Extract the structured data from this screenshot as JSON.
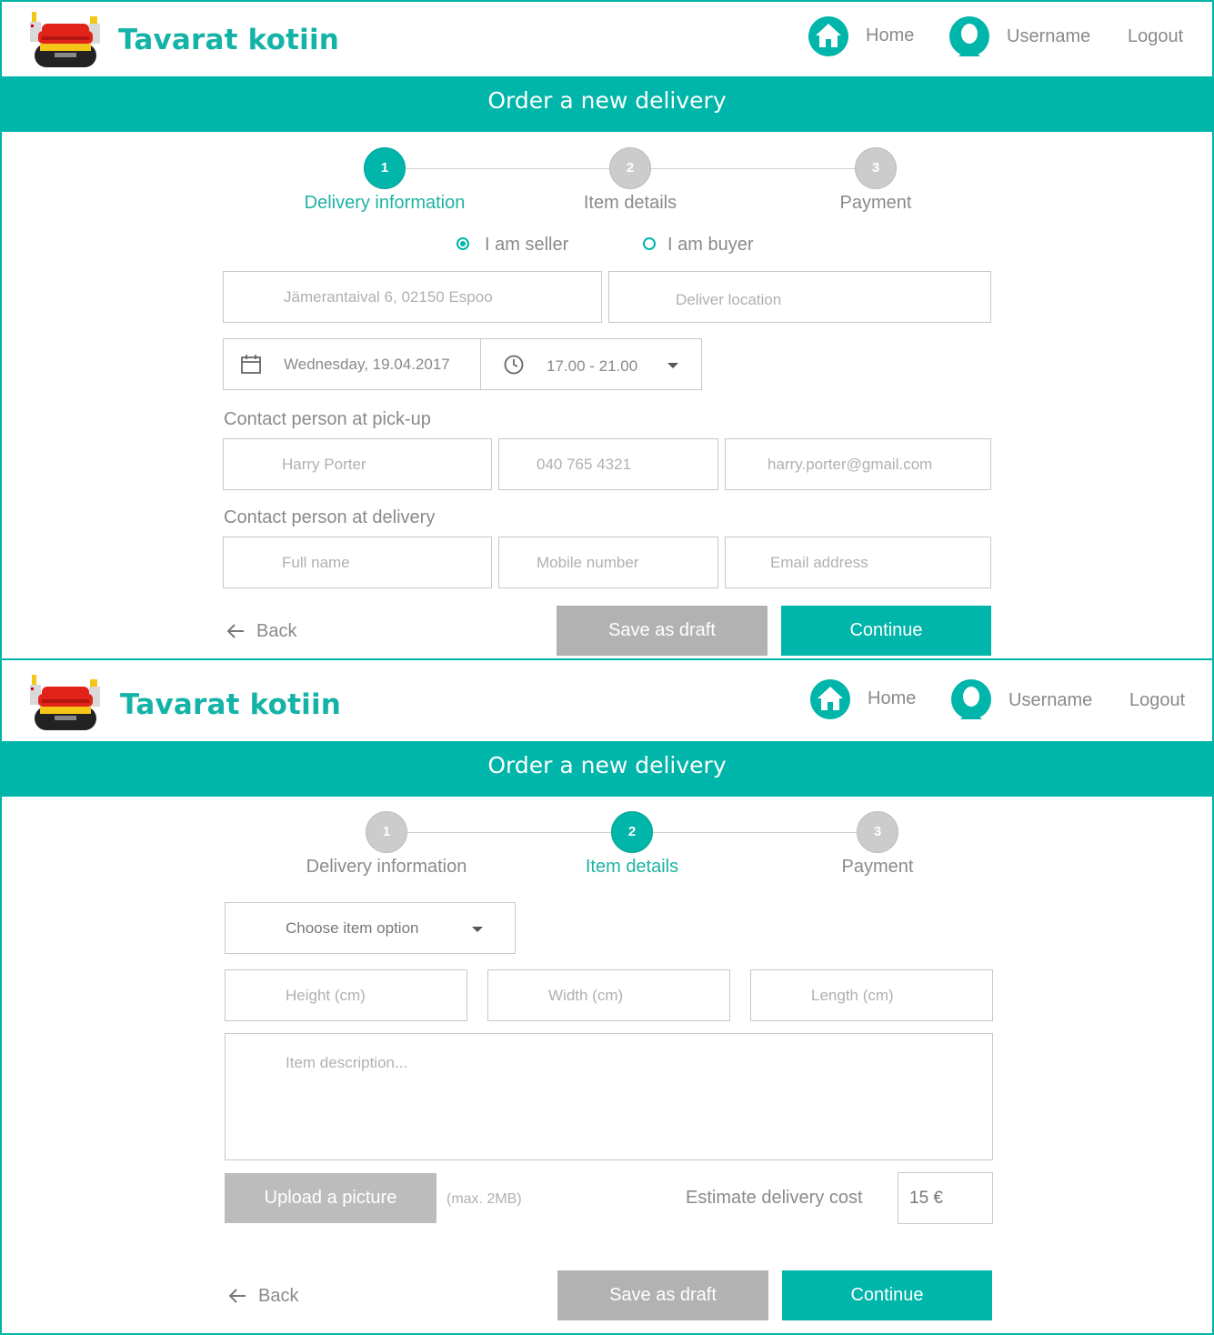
{
  "header": {
    "brand": "Tavarat kotiin",
    "nav": {
      "home": "Home",
      "username": "Username",
      "logout": "Logout"
    }
  },
  "colors": {
    "accent": "#00b5a9",
    "gray_button": "#b2b2b2",
    "brand_text": "#14b3a7"
  },
  "screen1": {
    "banner": "Order a new delivery",
    "steps": [
      {
        "number": "1",
        "label": "Delivery information",
        "active": true
      },
      {
        "number": "2",
        "label": "Item details",
        "active": false
      },
      {
        "number": "3",
        "label": "Payment",
        "active": false
      }
    ],
    "role": {
      "seller": "I am seller",
      "buyer": "I am buyer",
      "selected": "seller"
    },
    "pickup_address": "Jämerantaival 6, 02150 Espoo",
    "deliver_location_placeholder": "Deliver location",
    "date": "Wednesday, 19.04.2017",
    "time": "17.00 - 21.00",
    "pickup_contact": {
      "label": "Contact person at pick-up",
      "name": "Harry Porter",
      "phone": "040 765 4321",
      "email": "harry.porter@gmail.com"
    },
    "delivery_contact": {
      "label": "Contact person at delivery",
      "name_placeholder": "Full name",
      "phone_placeholder": "Mobile number",
      "email_placeholder": "Email address"
    },
    "back": "Back",
    "save_draft": "Save as draft",
    "continue": "Continue"
  },
  "screen2": {
    "banner": "Order a new delivery",
    "steps": [
      {
        "number": "1",
        "label": "Delivery information",
        "active": false
      },
      {
        "number": "2",
        "label": "Item details",
        "active": true
      },
      {
        "number": "3",
        "label": "Payment",
        "active": false
      }
    ],
    "item_option": "Choose item option",
    "height_placeholder": "Height (cm)",
    "width_placeholder": "Width (cm)",
    "length_placeholder": "Length (cm)",
    "description_placeholder": "Item description...",
    "upload": "Upload a picture",
    "upload_hint": "(max. 2MB)",
    "estimate_label": "Estimate delivery cost",
    "estimate_value": "15 €",
    "back": "Back",
    "save_draft": "Save as draft",
    "continue": "Continue"
  },
  "icons": [
    "sofa-logo-icon",
    "home-icon",
    "user-avatar-icon",
    "calendar-icon",
    "clock-icon",
    "chevron-down-icon",
    "arrow-left-icon"
  ]
}
